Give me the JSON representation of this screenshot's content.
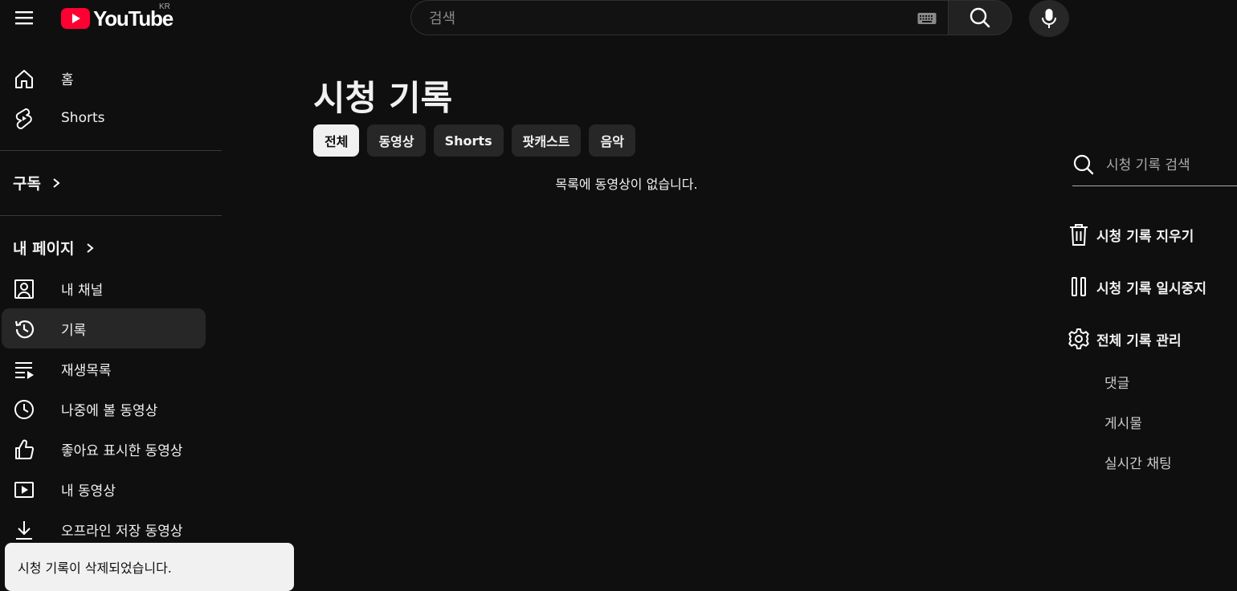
{
  "header": {
    "logo_text": "YouTube",
    "logo_region": "KR",
    "search_placeholder": "검색"
  },
  "sidebar": {
    "primary": [
      {
        "label": "홈",
        "icon": "home-icon"
      },
      {
        "label": "Shorts",
        "icon": "shorts-icon"
      }
    ],
    "subscriptions_label": "구독",
    "my_page_label": "내 페이지",
    "my_items": [
      {
        "label": "내 채널",
        "icon": "channel-icon"
      },
      {
        "label": "기록",
        "icon": "history-icon",
        "active": true
      },
      {
        "label": "재생목록",
        "icon": "playlist-icon"
      },
      {
        "label": "나중에 볼 동영상",
        "icon": "watch-later-icon"
      },
      {
        "label": "좋아요 표시한 동영상",
        "icon": "thumbs-up-icon"
      },
      {
        "label": "내 동영상",
        "icon": "my-videos-icon"
      },
      {
        "label": "오프라인 저장 동영상",
        "icon": "download-icon"
      }
    ]
  },
  "main": {
    "title": "시청 기록",
    "chips": [
      "전체",
      "동영상",
      "Shorts",
      "팟캐스트",
      "음악"
    ],
    "selected_chip": "전체",
    "empty_message": "목록에 동영상이 없습니다."
  },
  "right_panel": {
    "search_placeholder": "시청 기록 검색",
    "actions": [
      {
        "label": "시청 기록 지우기",
        "icon": "trash-icon"
      },
      {
        "label": "시청 기록 일시중지",
        "icon": "pause-icon"
      },
      {
        "label": "전체 기록 관리",
        "icon": "gear-icon"
      }
    ],
    "sublinks": [
      "댓글",
      "게시물",
      "실시간 채팅"
    ]
  },
  "toast": {
    "message": "시청 기록이 삭제되었습니다."
  },
  "colors": {
    "background": "#0f0f0f",
    "youtube_red": "#ff0033",
    "chip_bg": "#272727",
    "chip_selected_bg": "#f1f1f1",
    "toast_bg": "#f1f1f1"
  }
}
